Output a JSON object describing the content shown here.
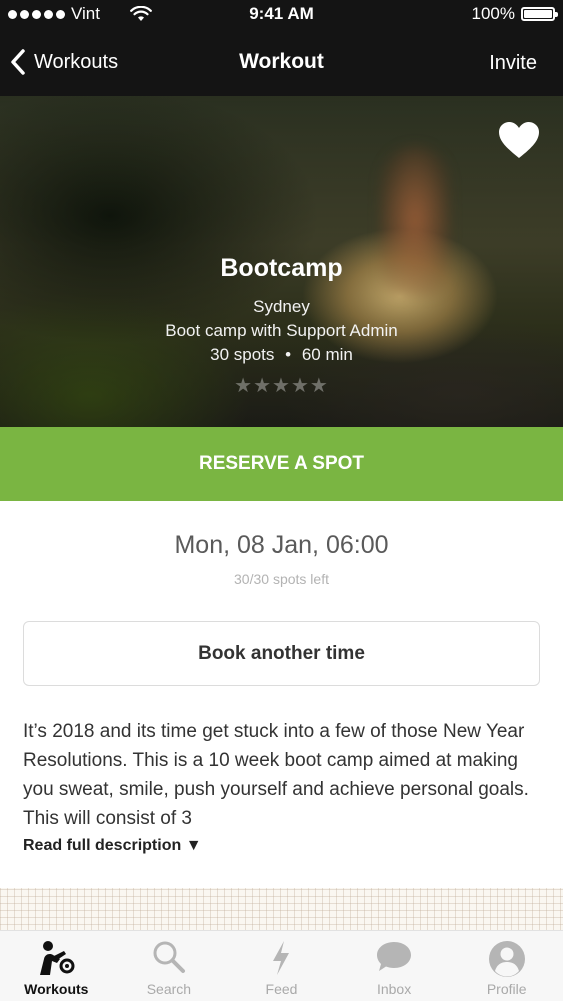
{
  "status_bar": {
    "carrier": "Vint",
    "time": "9:41 AM",
    "battery": "100%"
  },
  "nav": {
    "back_label": "Workouts",
    "title": "Workout",
    "action_label": "Invite"
  },
  "hero": {
    "name": "Bootcamp",
    "location": "Sydney",
    "subtitle": "Boot camp with Support Admin",
    "spots": "30 spots",
    "separator": "•",
    "duration": "60 min",
    "rating_stars": "★★★★★",
    "rating": 0,
    "rating_max": 5
  },
  "reserve_label": "RESERVE A SPOT",
  "session": {
    "date": "Mon, 08 Jan, 06:00",
    "spots_left": "30/30 spots left"
  },
  "book_another_label": "Book another time",
  "description": "It’s 2018 and its time get stuck into a few of those New Year Resolutions. This is a 10 week boot camp aimed at making you sweat, smile, push yourself and achieve personal goals. This will consist of 3",
  "read_more_label": "Read full description ▼",
  "tabs": [
    {
      "label": "Workouts",
      "icon": "workouts-icon",
      "active": true
    },
    {
      "label": "Search",
      "icon": "search-icon",
      "active": false
    },
    {
      "label": "Feed",
      "icon": "lightning-icon",
      "active": false
    },
    {
      "label": "Inbox",
      "icon": "chat-bubble-icon",
      "active": false
    },
    {
      "label": "Profile",
      "icon": "profile-icon",
      "active": false
    }
  ],
  "colors": {
    "accent": "#7ab542",
    "nav_background": "#141414"
  }
}
